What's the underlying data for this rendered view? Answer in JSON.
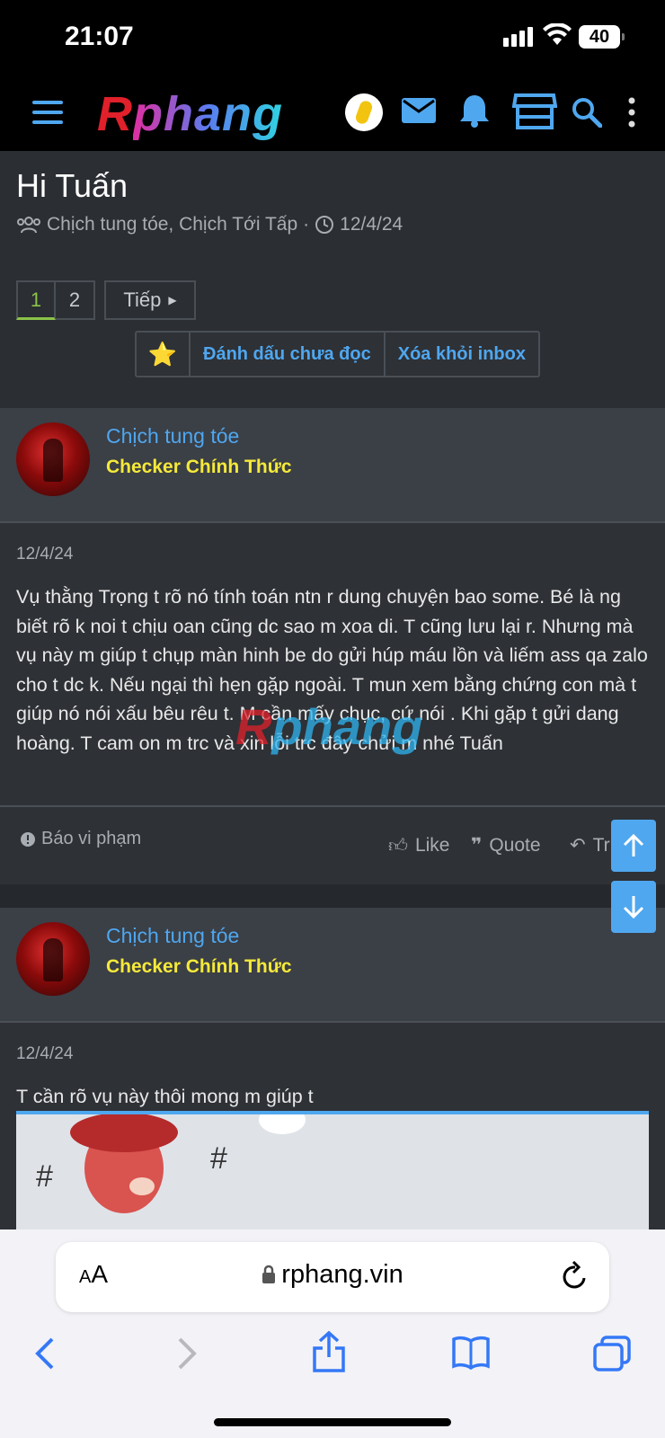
{
  "status_bar": {
    "time": "21:07",
    "battery": "40"
  },
  "nav": {
    "logo_r": "R",
    "logo_rest": "phang"
  },
  "thread": {
    "title": "Hi Tuấn",
    "participants": "Chịch tung tóe, Chịch Tới Tấp",
    "separator": "·",
    "date": "12/4/24"
  },
  "pager": {
    "page1": "1",
    "page2": "2",
    "next_label": "Tiếp"
  },
  "actions": {
    "mark_unread": "Đánh dấu chưa đọc",
    "remove_inbox": "Xóa khỏi inbox"
  },
  "messages": [
    {
      "author": "Chịch tung tóe",
      "user_title": "Checker Chính Thức",
      "date": "12/4/24",
      "body": "Vụ thằng Trọng t rõ nó tính toán ntn r dung chuyện bao some. Bé là ng biết rõ k noi t chịu oan cũng dc sao m xoa di. T cũng lưu lại r. Nhưng mà vụ này m giúp t chụp màn hinh be do gửi húp máu lồn và liếm ass qa zalo cho t dc k. Nếu ngại thì hẹn gặp ngoài. T mun xem bằng chứng con mà t giúp nó nói xấu bêu rêu t. M cần mấy chục, cứ nói . Khi gặp t gửi dang hoàng. T cam on m trc và xin lỗi trc đây chửi m nhé Tuấn",
      "report": "Báo vi phạm",
      "like": "Like",
      "quote": "Quote",
      "reply": "Tr"
    },
    {
      "author": "Chịch tung tóe",
      "user_title": "Checker Chính Thức",
      "date": "12/4/24",
      "body": "T cần rõ vụ này thôi mong m giúp t"
    }
  ],
  "browser": {
    "aa_small": "A",
    "aa_large": "A",
    "url": "rphang.vin"
  },
  "watermark": {
    "r": "R",
    "rest": "phang"
  },
  "colors": {
    "accent": "#4fa7ef",
    "user_title": "#f5e93a",
    "active_page": "#8bc34a",
    "background": "#2b2e33"
  }
}
